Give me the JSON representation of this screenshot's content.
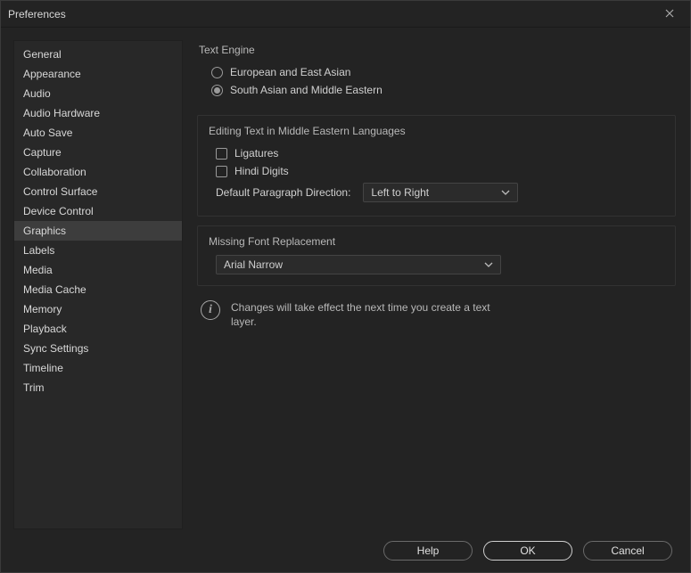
{
  "window": {
    "title": "Preferences"
  },
  "sidebar": {
    "items": [
      {
        "label": "General"
      },
      {
        "label": "Appearance"
      },
      {
        "label": "Audio"
      },
      {
        "label": "Audio Hardware"
      },
      {
        "label": "Auto Save"
      },
      {
        "label": "Capture"
      },
      {
        "label": "Collaboration"
      },
      {
        "label": "Control Surface"
      },
      {
        "label": "Device Control"
      },
      {
        "label": "Graphics",
        "selected": true
      },
      {
        "label": "Labels"
      },
      {
        "label": "Media"
      },
      {
        "label": "Media Cache"
      },
      {
        "label": "Memory"
      },
      {
        "label": "Playback"
      },
      {
        "label": "Sync Settings"
      },
      {
        "label": "Timeline"
      },
      {
        "label": "Trim"
      }
    ]
  },
  "content": {
    "textEngine": {
      "title": "Text Engine",
      "options": [
        {
          "label": "European and East Asian",
          "selected": true
        },
        {
          "label": "South Asian and Middle Eastern",
          "selected": false
        }
      ]
    },
    "editingText": {
      "title": "Editing Text in Middle Eastern Languages",
      "ligatures": {
        "label": "Ligatures",
        "checked": false
      },
      "hindiDigits": {
        "label": "Hindi Digits",
        "checked": false
      },
      "paragraphDirection": {
        "label": "Default Paragraph Direction:",
        "value": "Left to Right"
      }
    },
    "missingFont": {
      "title": "Missing Font Replacement",
      "value": "Arial Narrow"
    },
    "info": "Changes will take effect the next time you create a text layer."
  },
  "footer": {
    "help": "Help",
    "ok": "OK",
    "cancel": "Cancel"
  }
}
